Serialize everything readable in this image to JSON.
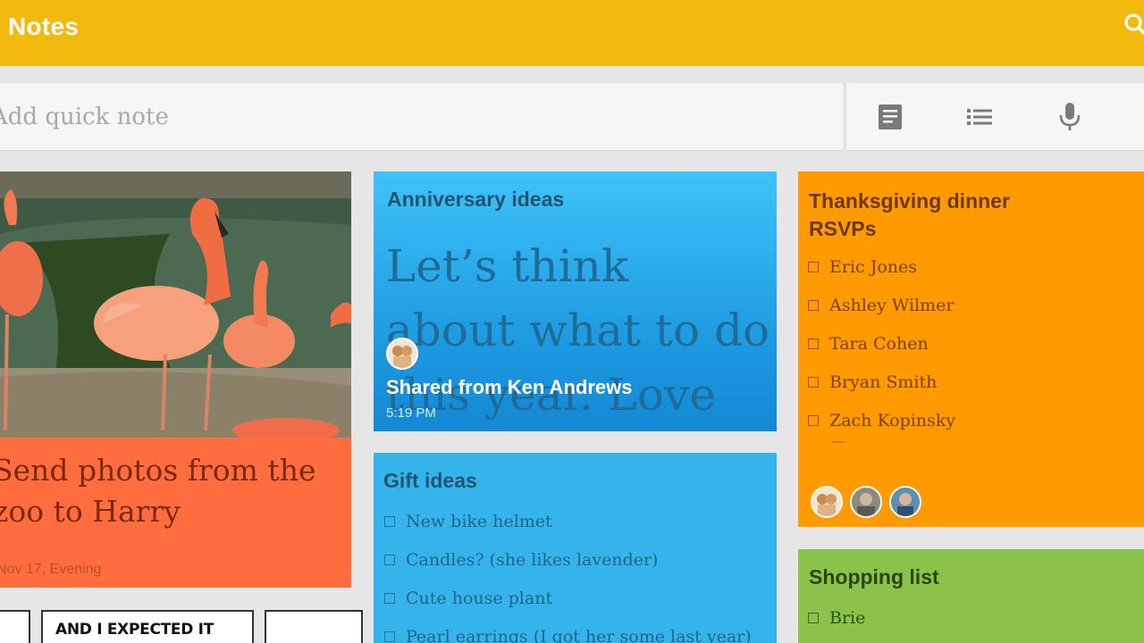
{
  "app": {
    "title": "Notes",
    "search_icon": "search-icon"
  },
  "quick_note": {
    "placeholder": "Add quick note"
  },
  "toolbar": {
    "icons": [
      "text-note-icon",
      "list-note-icon",
      "microphone-icon"
    ]
  },
  "notes": {
    "photo": {
      "text": "Send photos from the zoo to Harry",
      "date": "Nov 17, Evening",
      "color": "#ff6d3f"
    },
    "anniversary": {
      "title": "Anniversary ideas",
      "body": "Let’s think about what to do this year. Love you!",
      "shared_from": "Shared from Ken Andrews",
      "time": "5:19 PM",
      "color": "#29b6f6"
    },
    "gift": {
      "title": "Gift ideas",
      "items": [
        "New bike helmet",
        "Candles? (she likes lavender)",
        "Cute house plant",
        "Pearl earrings (I got her some last year)"
      ],
      "color": "#35b4ec"
    },
    "thanksgiving": {
      "title_line1": "Thanksgiving dinner",
      "title_line2": "RSVPs",
      "items": [
        "Eric Jones",
        "Ashley Wilmer",
        "Tara Cohen",
        "Bryan Smith",
        "Zach Kopinsky"
      ],
      "color": "#ff9a00"
    },
    "shopping": {
      "title": "Shopping list",
      "items": [
        "Brie"
      ],
      "color": "#8bc34a"
    },
    "comic": {
      "text": "AND I EXPECTED IT"
    }
  }
}
